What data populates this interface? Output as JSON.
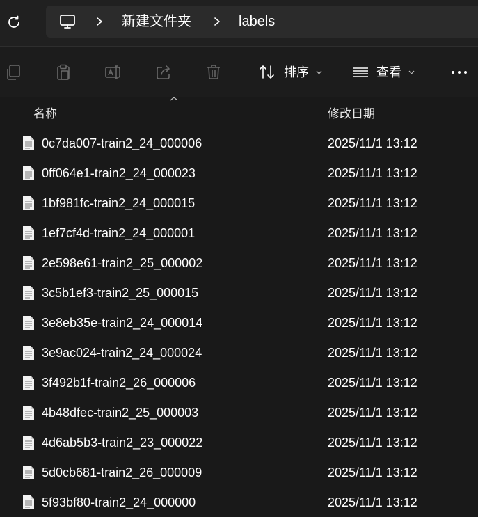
{
  "breadcrumb": {
    "folder": "新建文件夹",
    "current": "labels"
  },
  "toolbar": {
    "sort_label": "排序",
    "view_label": "查看"
  },
  "columns": {
    "name": "名称",
    "modified": "修改日期"
  },
  "files": [
    {
      "name": "0c7da007-train2_24_000006",
      "date": "2025/11/1 13:12"
    },
    {
      "name": "0ff064e1-train2_24_000023",
      "date": "2025/11/1 13:12"
    },
    {
      "name": "1bf981fc-train2_24_000015",
      "date": "2025/11/1 13:12"
    },
    {
      "name": "1ef7cf4d-train2_24_000001",
      "date": "2025/11/1 13:12"
    },
    {
      "name": "2e598e61-train2_25_000002",
      "date": "2025/11/1 13:12"
    },
    {
      "name": "3c5b1ef3-train2_25_000015",
      "date": "2025/11/1 13:12"
    },
    {
      "name": "3e8eb35e-train2_24_000014",
      "date": "2025/11/1 13:12"
    },
    {
      "name": "3e9ac024-train2_24_000024",
      "date": "2025/11/1 13:12"
    },
    {
      "name": "3f492b1f-train2_26_000006",
      "date": "2025/11/1 13:12"
    },
    {
      "name": "4b48dfec-train2_25_000003",
      "date": "2025/11/1 13:12"
    },
    {
      "name": "4d6ab5b3-train2_23_000022",
      "date": "2025/11/1 13:12"
    },
    {
      "name": "5d0cb681-train2_26_000009",
      "date": "2025/11/1 13:12"
    },
    {
      "name": "5f93bf80-train2_24_000000",
      "date": "2025/11/1 13:12"
    }
  ]
}
